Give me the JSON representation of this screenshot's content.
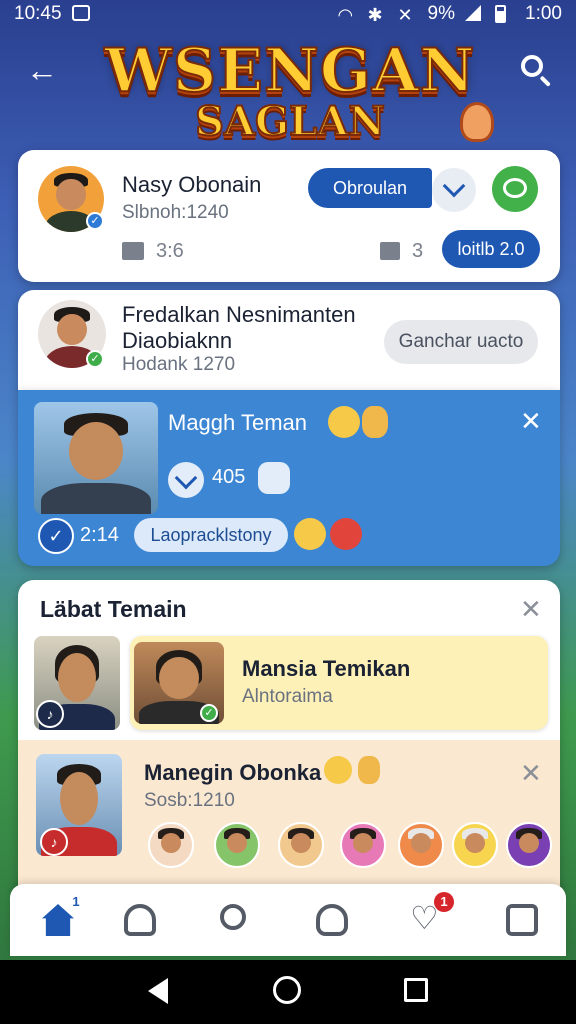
{
  "status_bar": {
    "time": "10:45",
    "battery_percent": "9%",
    "clock_right": "1:00"
  },
  "header": {
    "logo_line1": "WSENGAN",
    "logo_line2": "SAGLAN"
  },
  "card1": {
    "name": "Nasy Obonain",
    "sub": "Slbnoh:1240",
    "follow_label": "Obroulan",
    "stat1": "3:6",
    "stat2": "3",
    "action_label": "loitlb 2.0"
  },
  "card2": {
    "name_line1": "Fredalkan Nesnimanten",
    "name_line2": "Diaobiaknn",
    "sub": "Hodank 1270",
    "button_label": "Ganchar uacto"
  },
  "highlight": {
    "name": "Maggh Teman",
    "likes": "405",
    "count": "2:14",
    "pill_label": "Laopracklstony"
  },
  "card3": {
    "title": "Läbat Temain",
    "feature_name": "Mansia Temikan",
    "feature_sub": "Alntoraima",
    "peach_name": "Manegin Obonka",
    "peach_sub": "Sosb:1210"
  },
  "bottom_nav": {
    "home_badge": "1",
    "heart_badge": "1"
  },
  "colors": {
    "primary": "#1e58b3",
    "highlight": "#3d86d4",
    "accent_green": "#43b14a",
    "badge_red": "#d6262c"
  }
}
